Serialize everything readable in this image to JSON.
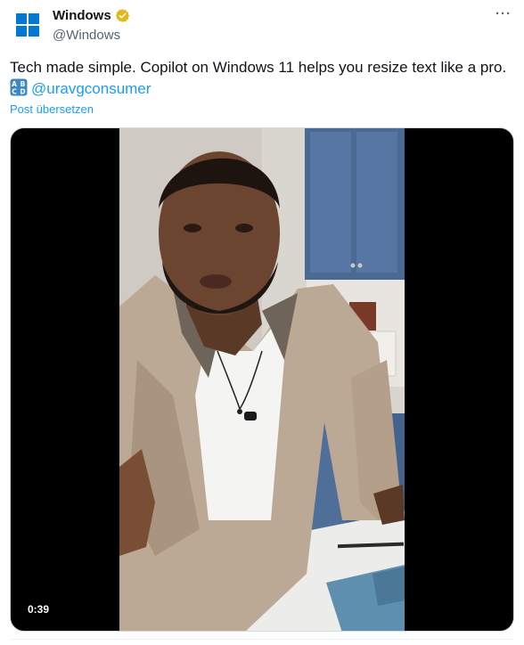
{
  "account": {
    "display_name": "Windows",
    "handle": "@Windows",
    "logo_icon": "windows-logo-icon",
    "verified_icon": "gold-verified-badge-icon",
    "brand_color": "#0078d4",
    "verified_color": "#e2b719"
  },
  "menu": {
    "more_label": "···"
  },
  "tweet": {
    "line1": "Tech made simple. Copilot on Windows 11 helps you resize text like a pro.",
    "emoji_icon": "abcd-input-symbol-icon",
    "mention": "@uravgconsumer",
    "translate_label": "Post übersetzen"
  },
  "video": {
    "duration": "0:39",
    "description_icon": "video-thumbnail-man-in-kitchen"
  },
  "colors": {
    "link": "#1d9bf0",
    "secondary_text": "#536471",
    "primary_text": "#0f1419"
  }
}
